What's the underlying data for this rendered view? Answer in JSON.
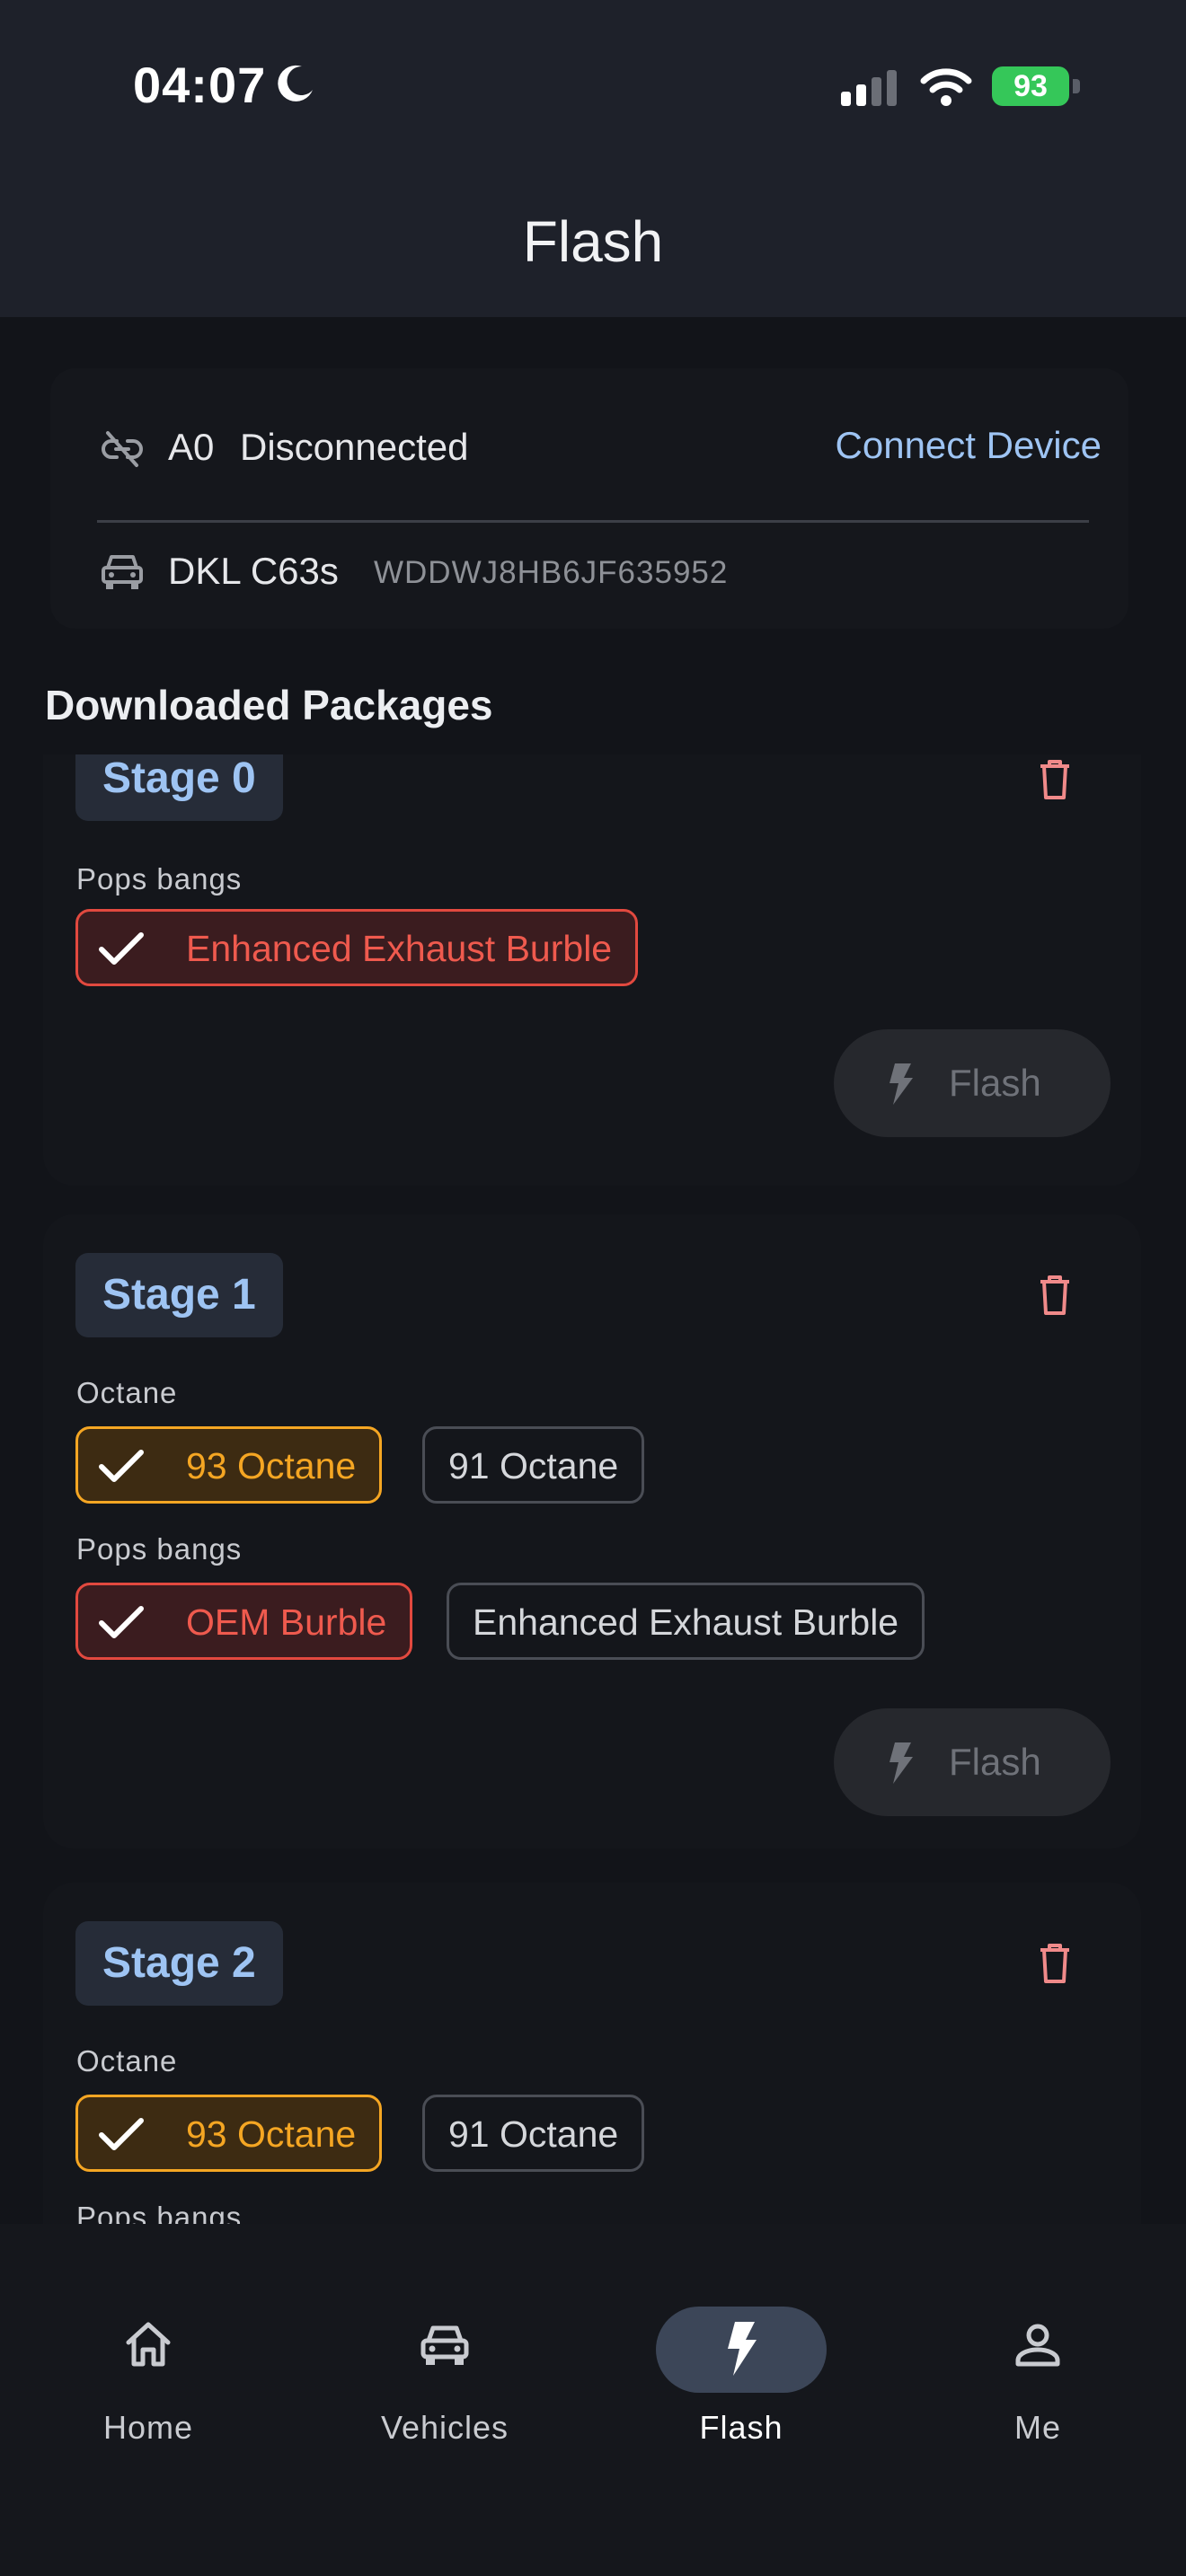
{
  "status_bar": {
    "time": "04:07",
    "battery": "93"
  },
  "app_bar": {
    "title": "Flash"
  },
  "device": {
    "name": "A0",
    "status": "Disconnected",
    "connect_label": "Connect Device",
    "vehicle_name": "DKL C63s",
    "vin": "WDDWJ8HB6JF635952"
  },
  "section_title": "Downloaded Packages",
  "packages": [
    {
      "stage": "Stage 0",
      "groups": [
        {
          "label": "Pops bangs",
          "options": [
            "Enhanced Exhaust Burble"
          ]
        }
      ],
      "flash_label": "Flash"
    },
    {
      "stage": "Stage 1",
      "groups": [
        {
          "label": "Octane",
          "options": [
            "93 Octane",
            "91 Octane"
          ]
        },
        {
          "label": "Pops bangs",
          "options": [
            "OEM Burble",
            "Enhanced Exhaust Burble"
          ]
        }
      ],
      "flash_label": "Flash"
    },
    {
      "stage": "Stage 2",
      "groups": [
        {
          "label": "Octane",
          "options": [
            "93 Octane",
            "91 Octane"
          ]
        },
        {
          "label": "Pops bangs",
          "options": []
        }
      ]
    }
  ],
  "nav": {
    "items": [
      {
        "label": "Home",
        "icon": "home-icon"
      },
      {
        "label": "Vehicles",
        "icon": "car-icon"
      },
      {
        "label": "Flash",
        "icon": "bolt-icon",
        "active": true
      },
      {
        "label": "Me",
        "icon": "person-icon"
      }
    ]
  },
  "colors": {
    "accent": "#9ec4f3",
    "selected_red": "#e2493f",
    "selected_orange": "#f5a623",
    "battery": "#35c759",
    "delete": "#f08a8a"
  }
}
